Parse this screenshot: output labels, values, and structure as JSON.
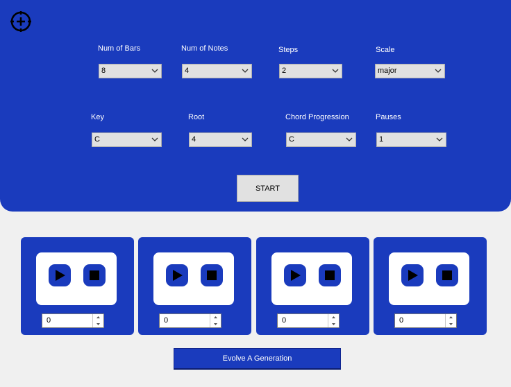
{
  "colors": {
    "panel": "#1a3bbd",
    "background": "#f0f0f0",
    "control": "#e1e1e1"
  },
  "top": {
    "add_icon": "plus-circle-icon",
    "fields": [
      {
        "label": "Num of Bars",
        "value": "8"
      },
      {
        "label": "Num of Notes",
        "value": "4"
      },
      {
        "label": "Steps",
        "value": "2"
      },
      {
        "label": "Scale",
        "value": "major"
      },
      {
        "label": "Key",
        "value": "C"
      },
      {
        "label": "Root",
        "value": "4"
      },
      {
        "label": "Chord Progression",
        "value": "C"
      },
      {
        "label": "Pauses",
        "value": "1"
      }
    ],
    "start_label": "START"
  },
  "cards": [
    {
      "play_icon": "play-icon",
      "stop_icon": "stop-icon",
      "value": "0"
    },
    {
      "play_icon": "play-icon",
      "stop_icon": "stop-icon",
      "value": "0"
    },
    {
      "play_icon": "play-icon",
      "stop_icon": "stop-icon",
      "value": "0"
    },
    {
      "play_icon": "play-icon",
      "stop_icon": "stop-icon",
      "value": "0"
    }
  ],
  "evolve_label": "Evolve A Generation"
}
